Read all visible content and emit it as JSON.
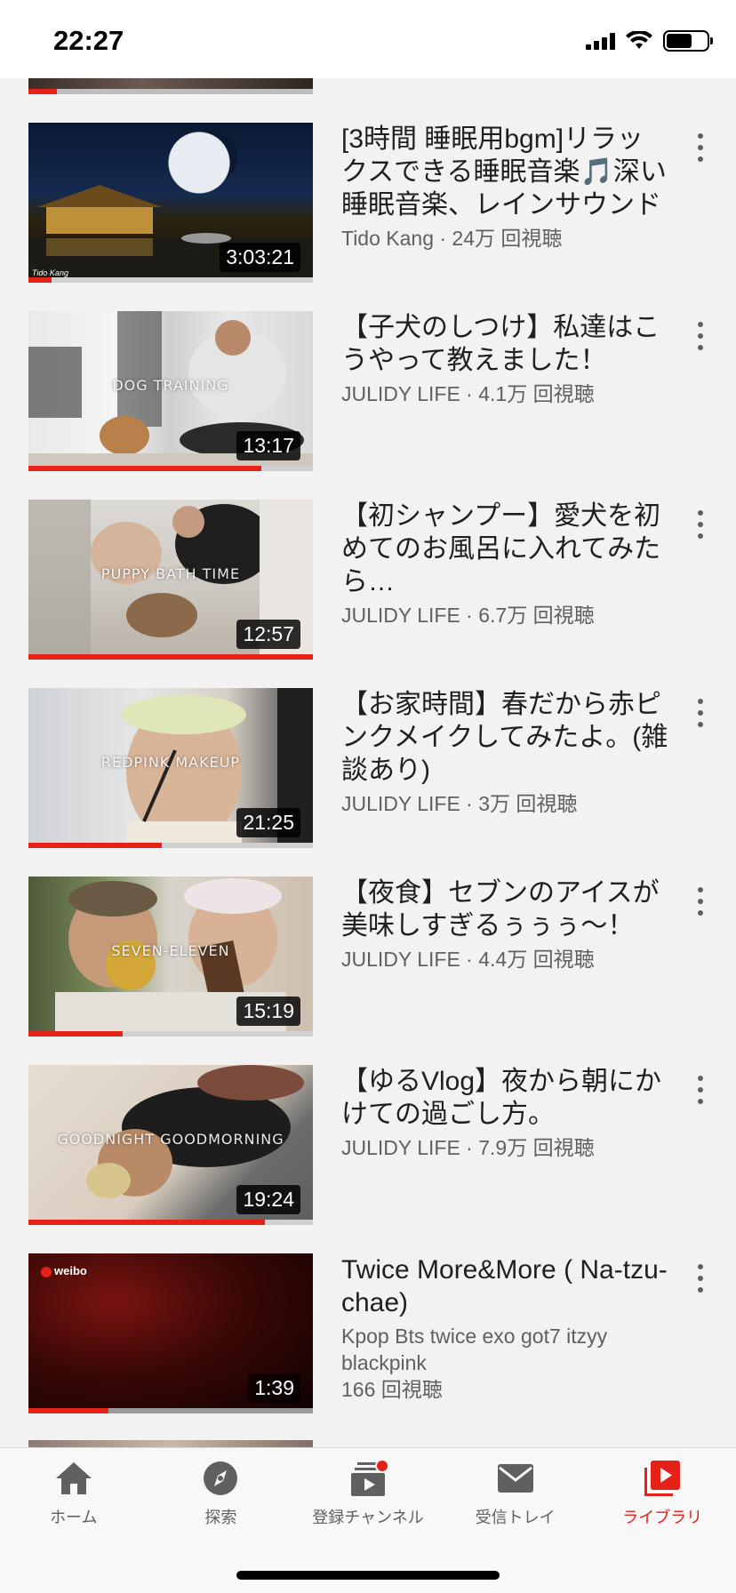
{
  "status_bar": {
    "time": "22:27"
  },
  "videos": [
    {
      "title": "[3時間 睡眠用bgm]リラックスできる睡眠音楽🎵深い睡眠音楽、レインサウンド",
      "meta": "Tido Kang · 24万 回視聴",
      "duration": "3:03:21",
      "overlay": "",
      "watermark": "Tido Kang",
      "progress_pct": 8
    },
    {
      "title": "【子犬のしつけ】私達はこうやって教えました！",
      "meta": "JULIDY LIFE · 4.1万 回視聴",
      "duration": "13:17",
      "overlay": "DOG TRAINING",
      "progress_pct": 82
    },
    {
      "title": "【初シャンプー】愛犬を初めてのお風呂に入れてみたら…",
      "meta": "JULIDY LIFE · 6.7万 回視聴",
      "duration": "12:57",
      "overlay": "PUPPY BATH TIME",
      "progress_pct": 100
    },
    {
      "title": "【お家時間】春だから赤ピンクメイクしてみたよ。(雑談あり)",
      "meta": "JULIDY LIFE · 3万 回視聴",
      "duration": "21:25",
      "overlay": "REDPINK MAKEUP",
      "progress_pct": 47
    },
    {
      "title": "【夜食】セブンのアイスが美味しすぎるぅぅぅ〜！",
      "meta": "JULIDY LIFE · 4.4万 回視聴",
      "duration": "15:19",
      "overlay": "SEVEN-ELEVEN",
      "progress_pct": 33
    },
    {
      "title": "【ゆるVlog】夜から朝にかけての過ごし方。",
      "meta": "JULIDY LIFE · 7.9万 回視聴",
      "duration": "19:24",
      "overlay": "GOODNIGHT GOODMORNING",
      "progress_pct": 83
    },
    {
      "title": "Twice More&More ( Na-tzu-chae)",
      "meta": "Kpop Bts twice exo got7 itzyy blackpink",
      "meta2": "166 回視聴",
      "duration": "1:39",
      "overlay": "",
      "watermark": "weibo",
      "progress_pct": 28
    }
  ],
  "tabs": [
    {
      "label": "ホーム",
      "icon": "home-icon"
    },
    {
      "label": "探索",
      "icon": "explore-icon"
    },
    {
      "label": "登録チャンネル",
      "icon": "subscriptions-icon"
    },
    {
      "label": "受信トレイ",
      "icon": "inbox-icon"
    },
    {
      "label": "ライブラリ",
      "icon": "library-icon",
      "active": true
    }
  ],
  "colors": {
    "accent": "#e62117",
    "text": "#1f1f1f",
    "meta": "#606060",
    "background": "#f2f2f2"
  }
}
